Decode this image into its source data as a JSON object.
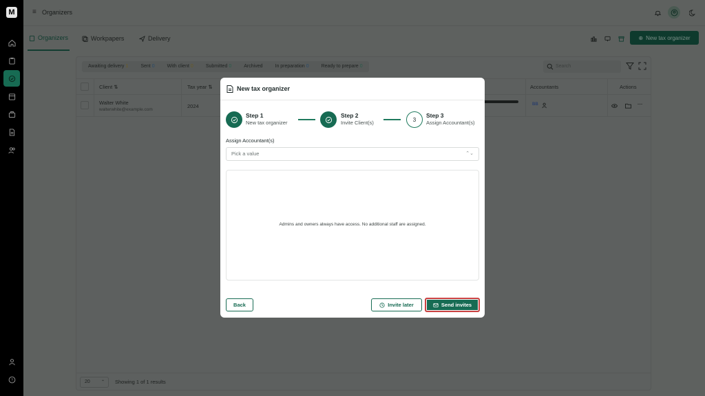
{
  "app": {
    "logo_letter": "M"
  },
  "topbar": {
    "title": "Organizers"
  },
  "tabs": [
    {
      "label": "Organizers",
      "active": true
    },
    {
      "label": "Workpapers",
      "active": false
    },
    {
      "label": "Delivery",
      "active": false
    }
  ],
  "toolbar": {
    "new_button_label": "New tax organizer"
  },
  "filters": [
    {
      "label": "Awaiting delivery",
      "count": "1"
    },
    {
      "label": "Sent",
      "count": "0"
    },
    {
      "label": "With client",
      "count": "0"
    },
    {
      "label": "Submitted",
      "count": "0"
    },
    {
      "label": "Archived",
      "count": ""
    },
    {
      "label": "In preparation",
      "count": "0"
    },
    {
      "label": "Ready to prepare",
      "count": "0"
    }
  ],
  "search": {
    "placeholder": "Search"
  },
  "table": {
    "headers": {
      "client": "Client ⇅",
      "tax_year": "Tax year ⇅",
      "accountants": "Accountants",
      "actions": "Actions"
    },
    "rows": [
      {
        "name": "Walter White",
        "email": "walterwhite@example.com",
        "tax_year": "2024",
        "accountant_initials": "BB"
      }
    ]
  },
  "footer": {
    "page_size": "20",
    "showing": "Showing 1 of 1 results"
  },
  "modal": {
    "title": "New tax organizer",
    "steps": [
      {
        "title": "Step 1",
        "subtitle": "New tax organizer",
        "state": "done"
      },
      {
        "title": "Step 2",
        "subtitle": "Invite Client(s)",
        "state": "done"
      },
      {
        "title": "Step 3",
        "subtitle": "Assign Accountant(s)",
        "state": "current",
        "number": "3"
      }
    ],
    "field_label": "Assign Accountant(s)",
    "select_placeholder": "Pick a value",
    "empty_message": "Admins and owners always have access. No additional staff are assigned.",
    "buttons": {
      "back": "Back",
      "invite_later": "Invite later",
      "send_invites": "Send invites"
    }
  },
  "colors": {
    "accent": "#176b53",
    "highlight_border": "#c94141",
    "overlay": "#5e615f"
  }
}
